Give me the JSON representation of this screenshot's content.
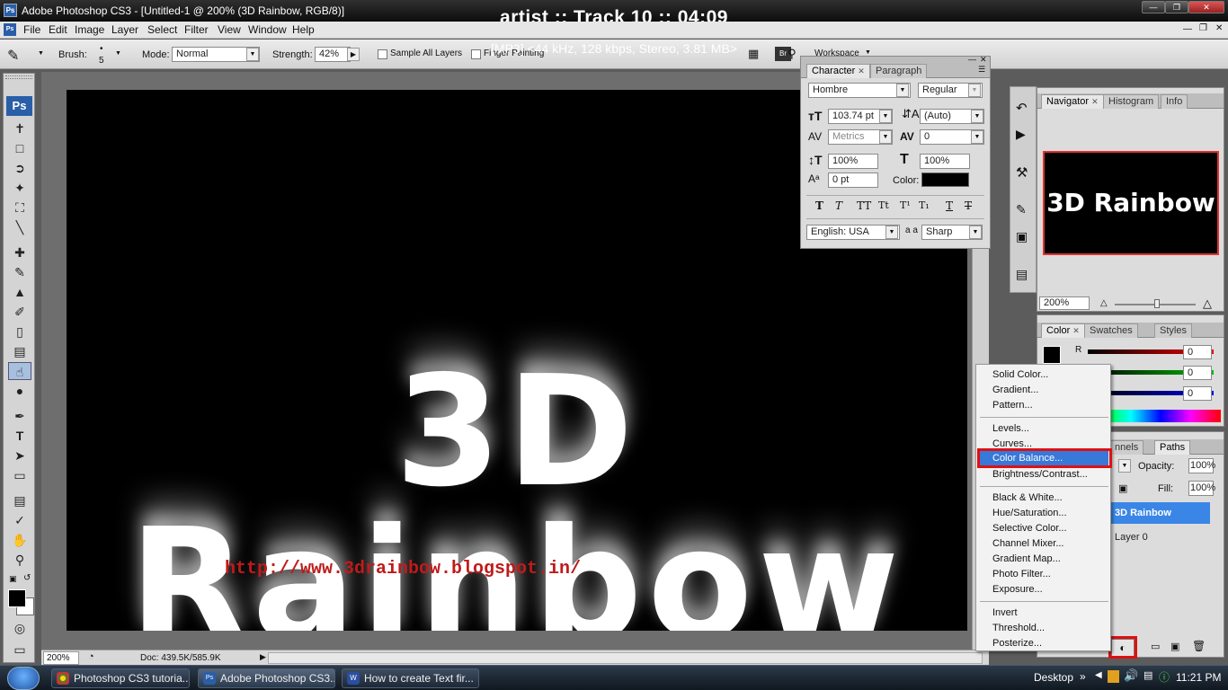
{
  "window": {
    "title": "Adobe Photoshop CS3 - [Untitled-1 @ 200% (3D Rainbow, RGB/8)]",
    "logo": "Ps"
  },
  "overlay": {
    "line1": "artist :: Track 10 :: 04:09",
    "line2": "[MP3] <44 kHz, 128 kbps, Stereo, 3.81 MB>"
  },
  "menubar": {
    "items": [
      "File",
      "Edit",
      "Image",
      "Layer",
      "Select",
      "Filter",
      "View",
      "Window",
      "Help"
    ]
  },
  "options": {
    "brush_label": "Brush:",
    "brush_size": "5",
    "mode_label": "Mode:",
    "mode_value": "Normal",
    "strength_label": "Strength:",
    "strength_value": "42%",
    "sample_all_layers": "Sample All Layers",
    "finger_painting": "Finger Painting",
    "workspace": "Workspace"
  },
  "canvas": {
    "text": "3D Rainbow",
    "url": "http://www.3drainbow.blogspot.in/"
  },
  "status": {
    "zoom": "200%",
    "doc": "Doc: 439.5K/585.9K"
  },
  "character_panel": {
    "tabs": [
      "Character",
      "Paragraph"
    ],
    "font_family": "Hombre",
    "font_style": "Regular",
    "size": "103.74 pt",
    "leading": "(Auto)",
    "kerning": "Metrics",
    "tracking": "0",
    "vscale": "100%",
    "hscale": "100%",
    "baseline": "0 pt",
    "color_label": "Color:",
    "language": "English: USA",
    "aa_label": "a a",
    "antialias": "Sharp",
    "style_buttons": [
      "T",
      "T",
      "TT",
      "Tt",
      "T¹",
      "T₁",
      "T",
      "T"
    ]
  },
  "navigator": {
    "tabs": [
      "Navigator",
      "Histogram",
      "Info"
    ],
    "preview_text": "3D Rainbow",
    "zoom": "200%"
  },
  "color_panel": {
    "tabs": [
      "Color",
      "Swatches",
      "Styles"
    ],
    "r_label": "R",
    "r": "0",
    "g": "0",
    "b": "0"
  },
  "layers_panel": {
    "tabs": [
      "nnels",
      "Paths"
    ],
    "opacity_label": "Opacity:",
    "opacity": "100%",
    "fill_label": "Fill:",
    "fill": "100%",
    "layers": [
      "3D Rainbow",
      "Layer 0"
    ]
  },
  "adjust_menu": {
    "groups": [
      [
        "Solid Color...",
        "Gradient...",
        "Pattern..."
      ],
      [
        "Levels...",
        "Curves...",
        "Color Balance...",
        "Brightness/Contrast..."
      ],
      [
        "Black & White...",
        "Hue/Saturation...",
        "Selective Color...",
        "Channel Mixer...",
        "Gradient Map...",
        "Photo Filter...",
        "Exposure..."
      ],
      [
        "Invert",
        "Threshold...",
        "Posterize..."
      ]
    ],
    "highlighted": "Color Balance..."
  },
  "taskbar": {
    "items": [
      "Photoshop CS3 tutoria...",
      "Adobe Photoshop CS3...",
      "How to create Text fir..."
    ],
    "desktop": "Desktop",
    "clock": "11:21 PM"
  }
}
